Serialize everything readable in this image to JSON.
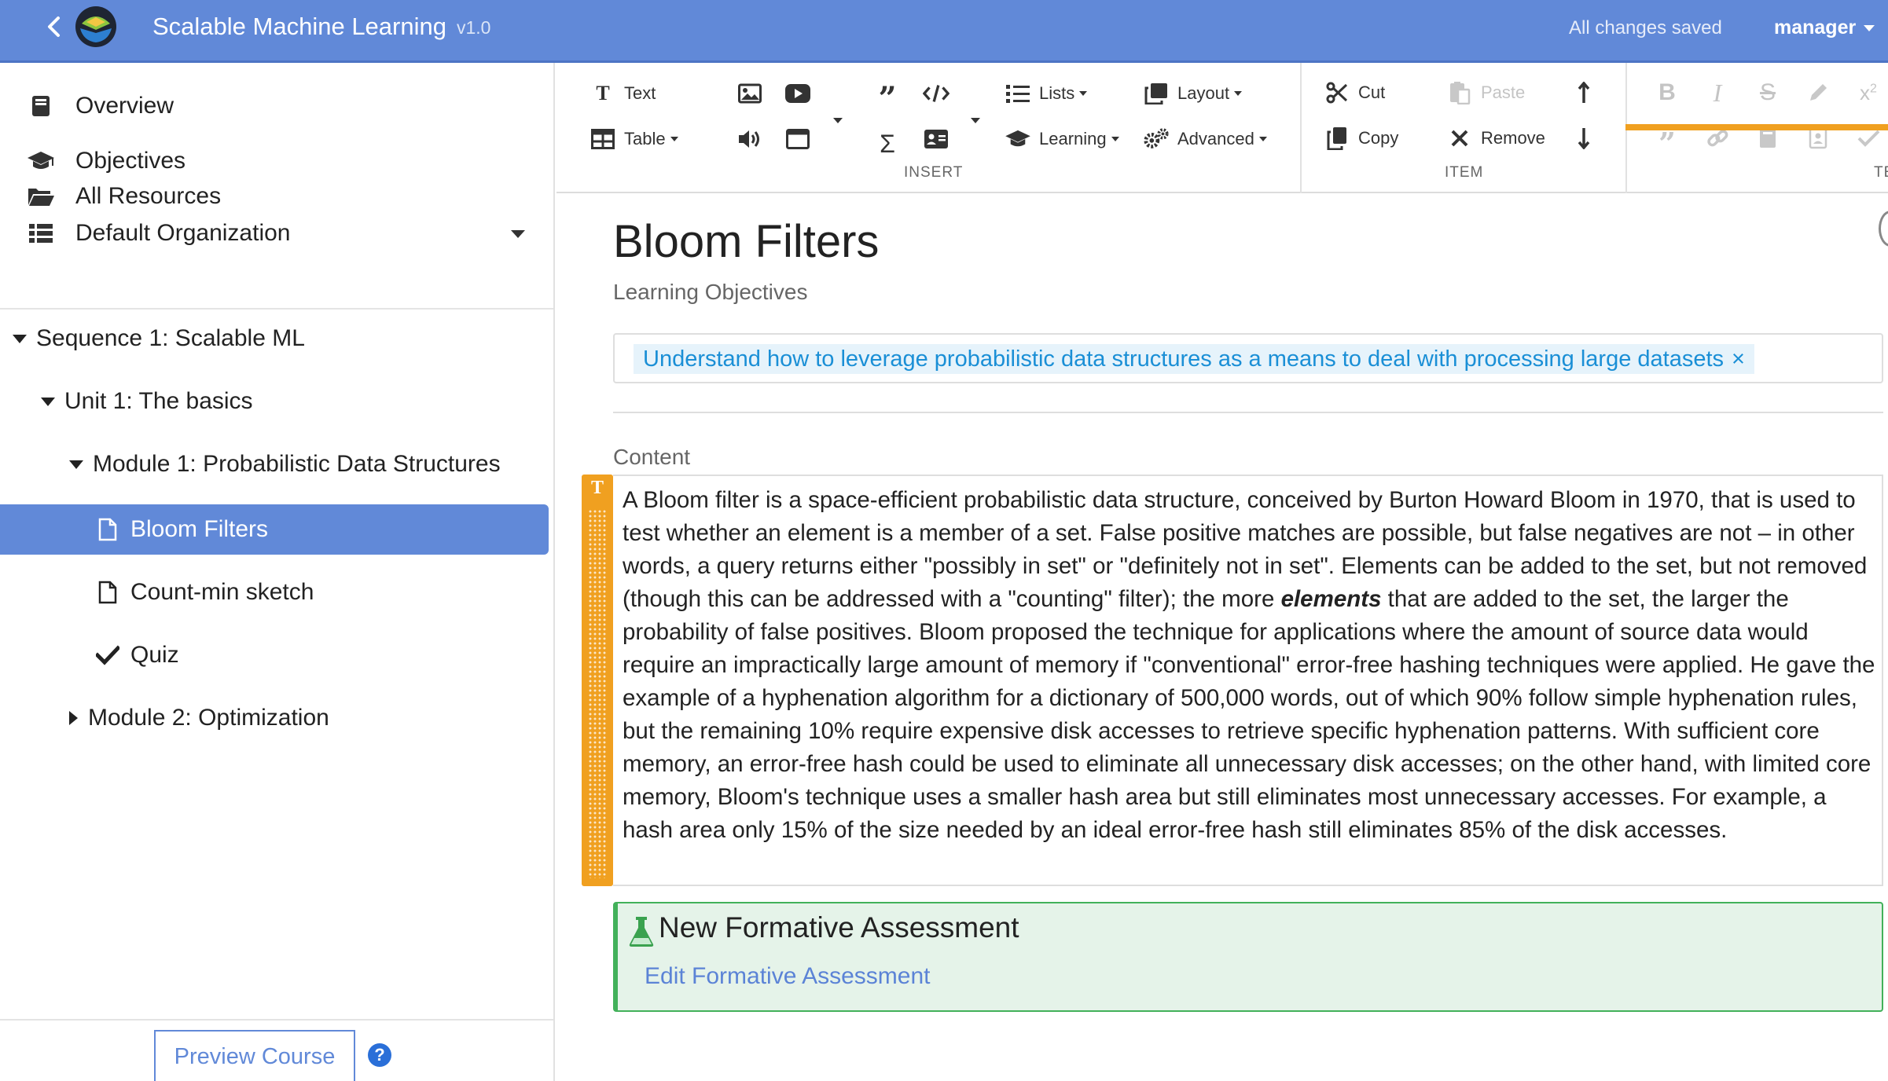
{
  "app": {
    "title": "Scalable Machine Learning",
    "version": "v1.0",
    "save_status": "All changes saved",
    "user": "manager",
    "colors": {
      "primary": "#6189d8",
      "text_block": "#f0a020",
      "assessment": "#42b15a",
      "objective_tag": "#1a8fd6"
    }
  },
  "sidebar": {
    "nav": [
      {
        "label": "Overview",
        "icon": "book-icon"
      },
      {
        "label": "Objectives",
        "icon": "graduation-cap-icon"
      },
      {
        "label": "All Resources",
        "icon": "folder-open-icon"
      },
      {
        "label": "Default Organization",
        "icon": "list-icon"
      }
    ],
    "tree": [
      {
        "label": "Sequence 1: Scalable ML",
        "expanded": true
      },
      {
        "label": "Unit 1: The basics",
        "expanded": true
      },
      {
        "label": "Module 1: Probabilistic Data Structures",
        "expanded": true
      },
      {
        "label": "Bloom Filters",
        "icon": "file-icon",
        "selected": true
      },
      {
        "label": "Count-min sketch",
        "icon": "file-icon"
      },
      {
        "label": "Quiz",
        "icon": "check-icon"
      },
      {
        "label": "Module 2: Optimization",
        "expanded": false
      }
    ],
    "preview_button": "Preview Course",
    "help_icon": "?"
  },
  "toolbar": {
    "insert": {
      "group_label": "INSERT",
      "text": "Text",
      "table": "Table",
      "lists": "Lists",
      "learning": "Learning",
      "layout": "Layout",
      "advanced": "Advanced"
    },
    "item": {
      "group_label": "ITEM",
      "cut": "Cut",
      "copy": "Copy",
      "paste": "Paste",
      "remove": "Remove"
    },
    "text_group_label_partial": "TE"
  },
  "page": {
    "title": "Bloom Filters",
    "objectives_label": "Learning Objectives",
    "objectives": [
      "Understand how to leverage probabilistic data structures as a means to deal with processing large datasets"
    ],
    "content_label": "Content",
    "text_block_marker": "T",
    "paragraph": {
      "before": "A Bloom filter is a space-efficient probabilistic data structure, conceived by Burton Howard Bloom in 1970, that is used to test whether an element is a member of a set. False positive matches are possible, but false negatives are not – in other words, a query returns either \"possibly in set\" or \"definitely not in set\". Elements can be added to the set, but not removed (though this can be addressed with a \"counting\" filter); the more ",
      "emphasis": "elements",
      "after": " that are added to the set, the larger the probability of false positives. Bloom proposed the technique for applications where the amount of source data would require an impractically large amount of memory if \"conventional\" error-free hashing techniques were applied. He gave the example of a hyphenation algorithm for a dictionary of 500,000 words, out of which 90% follow simple hyphenation rules, but the remaining 10% require expensive disk accesses to retrieve specific hyphenation patterns. With sufficient core memory, an error-free hash could be used to eliminate all unnecessary disk accesses; on the other hand, with limited core memory, Bloom's technique uses a smaller hash area but still eliminates most unnecessary accesses. For example, a hash area only 15% of the size needed by an ideal error-free hash still eliminates 85% of the disk accesses."
    },
    "assessment": {
      "title": "New Formative Assessment",
      "edit_link": "Edit Formative Assessment"
    }
  }
}
